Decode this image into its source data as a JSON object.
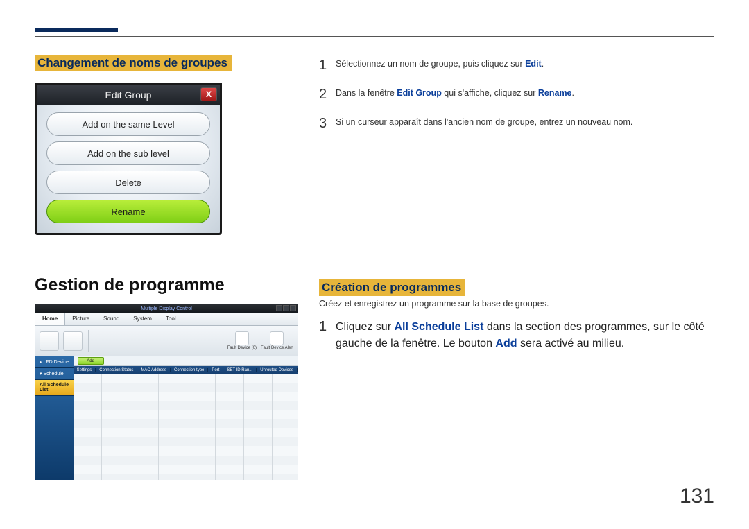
{
  "page_number": "131",
  "section1": {
    "heading_left": "Changement de noms de groupes",
    "dialog": {
      "title": "Edit Group",
      "close": "X",
      "btn1": "Add on the same Level",
      "btn2": "Add on the sub level",
      "btn3": "Delete",
      "btn4": "Rename"
    },
    "steps": {
      "s1": {
        "n": "1",
        "pre": "Sélectionnez un nom de groupe, puis cliquez sur ",
        "link": "Edit",
        "post": "."
      },
      "s2": {
        "n": "2",
        "pre": "Dans la fenêtre ",
        "link1": "Edit Group",
        "mid": " qui s'affiche, cliquez sur ",
        "link2": "Rename",
        "post": "."
      },
      "s3": {
        "n": "3",
        "txt": "Si un curseur apparaît dans l'ancien nom de groupe, entrez un nouveau nom."
      }
    }
  },
  "section2": {
    "heading_big": "Gestion de programme",
    "heading_right": "Création de programmes",
    "intro": "Créez et enregistrez un programme sur la base de groupes.",
    "step1": {
      "n": "1",
      "pre": "Cliquez sur ",
      "link1": "All Schedule List",
      "mid": " dans la section des programmes, sur le côté gauche de la fenêtre. Le bouton ",
      "link2": "Add",
      "post": " sera activé au milieu."
    },
    "mdc": {
      "title": "Multiple Display Control",
      "tabs": [
        "Home",
        "Picture",
        "Sound",
        "System",
        "Tool"
      ],
      "fault1": "Fault Device (0)",
      "fault2": "Fault Device Alert",
      "add": "Add",
      "side": {
        "lfd": "LFD Device",
        "sched": "Schedule",
        "all": "All Schedule List"
      },
      "headers": [
        "Settings",
        "Connection Status",
        "MAC Address",
        "Connection type",
        "Port",
        "SET ID Ran...",
        "Unrouted Devices"
      ]
    }
  }
}
